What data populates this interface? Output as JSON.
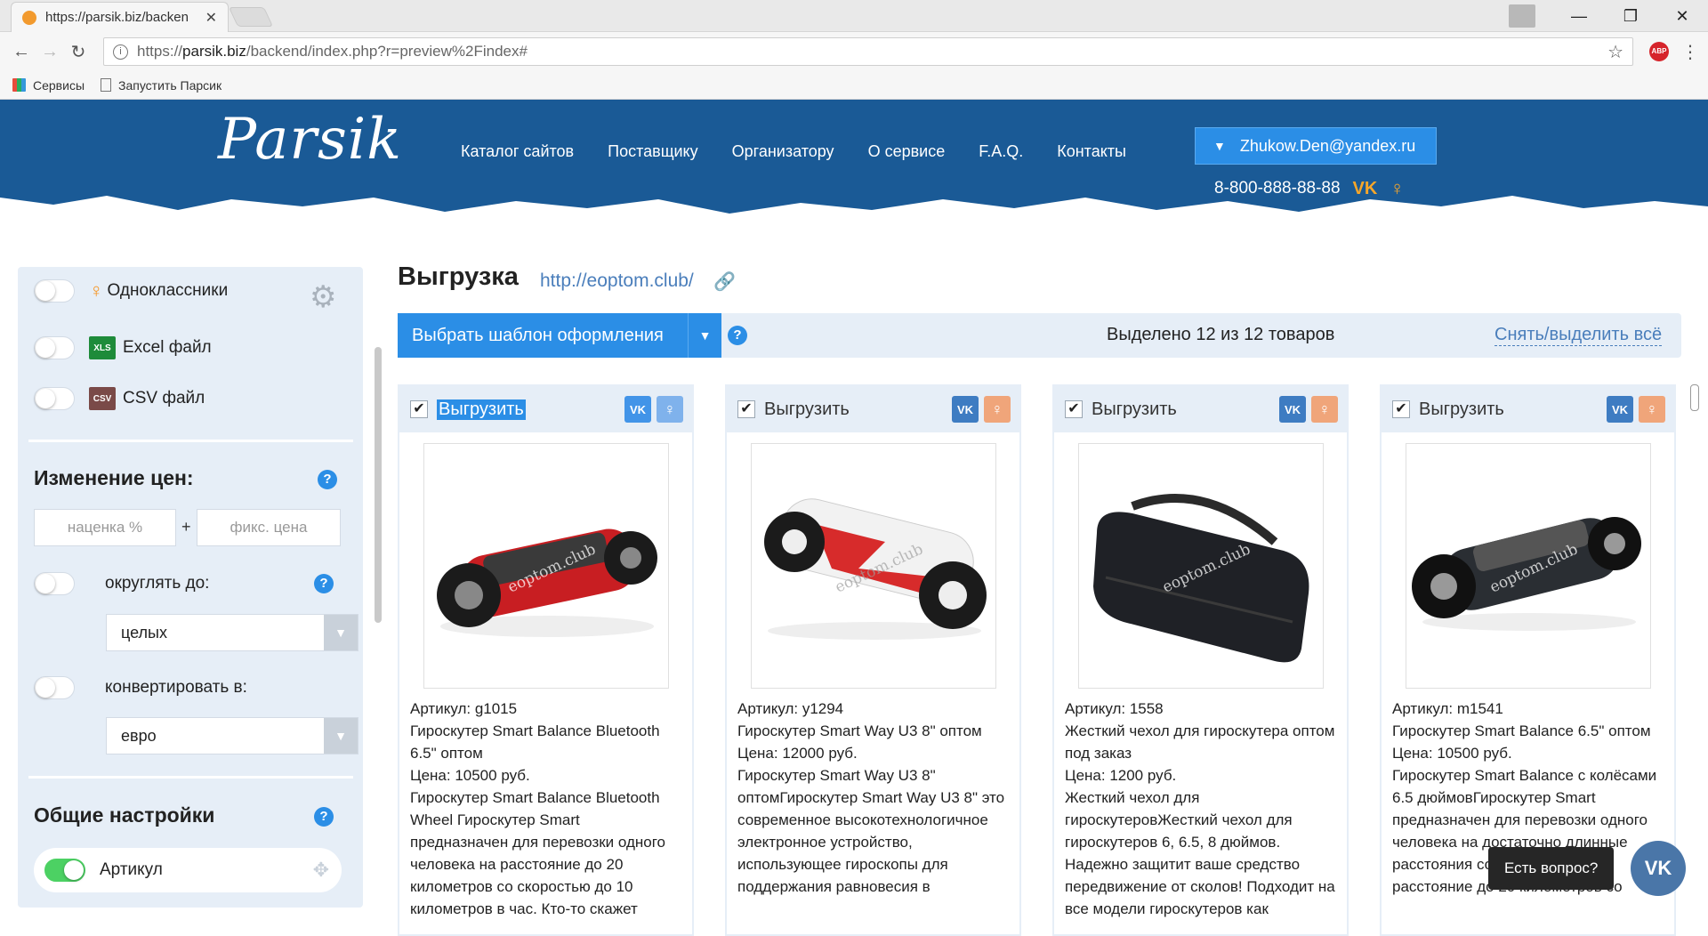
{
  "browser": {
    "tab_title": "https://parsik.biz/backen",
    "url_prefix": "https://",
    "url_domain": "parsik.biz",
    "url_path": "/backend/index.php?r=preview%2Findex#",
    "bookmarks": [
      {
        "label": "Сервисы"
      },
      {
        "label": "Запустить Парсик"
      }
    ]
  },
  "header": {
    "logo_text": "Parsik",
    "nav": [
      "Каталог сайтов",
      "Поставщику",
      "Организатору",
      "О сервисе",
      "F.A.Q.",
      "Контакты"
    ],
    "user_email": "Zhukow.Den@yandex.ru",
    "phone": "8-800-888-88-88",
    "brand_color": "#1a5a96",
    "accent_color": "#f7a629"
  },
  "sidebar": {
    "exports": [
      {
        "label": "Одноклассники",
        "on": false
      },
      {
        "label": "Excel файл",
        "icon_text": "XLS",
        "on": false
      },
      {
        "label": "CSV файл",
        "icon_text": "CSV",
        "on": false
      }
    ],
    "price_section": {
      "title": "Изменение цен:",
      "markup_placeholder": "наценка %",
      "plus": "+",
      "fixed_placeholder": "фикс. цена",
      "round_label": "округлять до:",
      "round_value": "целых",
      "convert_label": "конвертировать в:",
      "convert_value": "евро"
    },
    "general_section": {
      "title": "Общие настройки",
      "article_label": "Артикул",
      "article_on": true
    }
  },
  "main": {
    "title": "Выгрузка",
    "url": "http://eoptom.club/",
    "template_button": "Выбрать шаблон оформления",
    "selected_text": "Выделено 12 из 12 товаров",
    "toggle_all": "Снять/выделить всё"
  },
  "cards": [
    {
      "export_label": "Выгрузить",
      "checked": true,
      "highlighted": true,
      "article": "Артикул: g1015",
      "name": "Гироскутер Smart Balance Bluetooth 6.5\" оптом",
      "price": "Цена: 10500 руб.",
      "description": "Гироскутер Smart Balance Bluetooth Wheel Гироскутер Smart предназначен для перевозки одного человека на расстояние до 20 километров со скоростью до 10 километров в час. Кто-то скажет",
      "watermark": "eoptom.club"
    },
    {
      "export_label": "Выгрузить",
      "checked": true,
      "highlighted": false,
      "article": "Артикул: y1294",
      "name": "Гироскутер Smart Way U3 8\" оптом",
      "price": "Цена: 12000 руб.",
      "description": "Гироскутер Smart Way U3 8\" оптомГироскутер Smart Way U3 8\" это современное высокотехнологичное электронное устройство, использующее гироскопы для поддержания равновесия в",
      "watermark": "eoptom.club"
    },
    {
      "export_label": "Выгрузить",
      "checked": true,
      "highlighted": false,
      "article": "Артикул: 1558",
      "name": "Жесткий чехол для гироскутера оптом под заказ",
      "price": "Цена: 1200 руб.",
      "description": "Жесткий чехол для гироскутеровЖесткий чехол для гироскутеров 6, 6.5, 8 дюймов. Надежно защитит ваше средство передвижение от сколов! Подходит на все модели гироскутеров как",
      "watermark": "eoptom.club"
    },
    {
      "export_label": "Выгрузить",
      "checked": true,
      "highlighted": false,
      "article": "Артикул: m1541",
      "name": "Гироскутер Smart Balance 6.5\" оптом",
      "price": "Цена: 10500 руб.",
      "description": "Гироскутер Smart Balance с колёсами 6.5 дюймовГироскутер Smart предназначен для перевозки одного человека на достаточно длинные расстояния со скоростью до на расстояние до 20 километров со",
      "watermark": "eoptom.club"
    }
  ],
  "chat": {
    "question": "Есть вопрос?",
    "vk_label": "VK"
  }
}
